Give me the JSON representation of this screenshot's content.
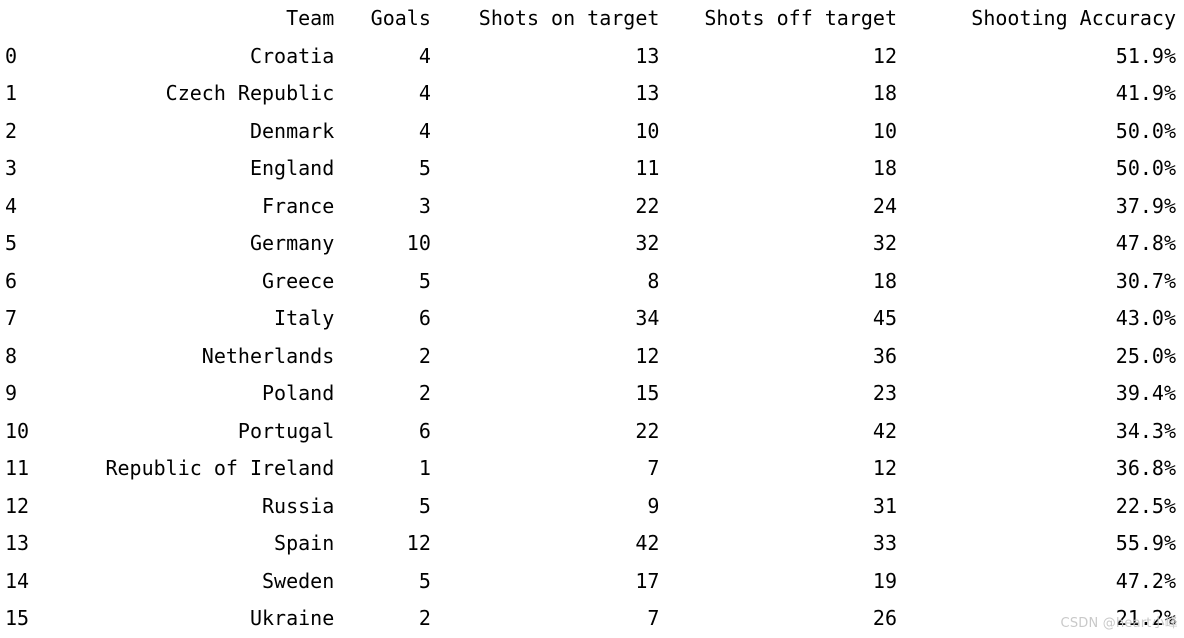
{
  "table": {
    "index_header": "",
    "columns": [
      "Team",
      "Goals",
      "Shots on target",
      "Shots off target",
      "Shooting Accuracy"
    ],
    "rows": [
      {
        "index": "0",
        "team": "Croatia",
        "goals": "4",
        "shots_on": "13",
        "shots_off": "12",
        "accuracy": "51.9%"
      },
      {
        "index": "1",
        "team": "Czech Republic",
        "goals": "4",
        "shots_on": "13",
        "shots_off": "18",
        "accuracy": "41.9%"
      },
      {
        "index": "2",
        "team": "Denmark",
        "goals": "4",
        "shots_on": "10",
        "shots_off": "10",
        "accuracy": "50.0%"
      },
      {
        "index": "3",
        "team": "England",
        "goals": "5",
        "shots_on": "11",
        "shots_off": "18",
        "accuracy": "50.0%"
      },
      {
        "index": "4",
        "team": "France",
        "goals": "3",
        "shots_on": "22",
        "shots_off": "24",
        "accuracy": "37.9%"
      },
      {
        "index": "5",
        "team": "Germany",
        "goals": "10",
        "shots_on": "32",
        "shots_off": "32",
        "accuracy": "47.8%"
      },
      {
        "index": "6",
        "team": "Greece",
        "goals": "5",
        "shots_on": "8",
        "shots_off": "18",
        "accuracy": "30.7%"
      },
      {
        "index": "7",
        "team": "Italy",
        "goals": "6",
        "shots_on": "34",
        "shots_off": "45",
        "accuracy": "43.0%"
      },
      {
        "index": "8",
        "team": "Netherlands",
        "goals": "2",
        "shots_on": "12",
        "shots_off": "36",
        "accuracy": "25.0%"
      },
      {
        "index": "9",
        "team": "Poland",
        "goals": "2",
        "shots_on": "15",
        "shots_off": "23",
        "accuracy": "39.4%"
      },
      {
        "index": "10",
        "team": "Portugal",
        "goals": "6",
        "shots_on": "22",
        "shots_off": "42",
        "accuracy": "34.3%"
      },
      {
        "index": "11",
        "team": "Republic of Ireland",
        "goals": "1",
        "shots_on": "7",
        "shots_off": "12",
        "accuracy": "36.8%"
      },
      {
        "index": "12",
        "team": "Russia",
        "goals": "5",
        "shots_on": "9",
        "shots_off": "31",
        "accuracy": "22.5%"
      },
      {
        "index": "13",
        "team": "Spain",
        "goals": "12",
        "shots_on": "42",
        "shots_off": "33",
        "accuracy": "55.9%"
      },
      {
        "index": "14",
        "team": "Sweden",
        "goals": "5",
        "shots_on": "17",
        "shots_off": "19",
        "accuracy": "47.2%"
      },
      {
        "index": "15",
        "team": "Ukraine",
        "goals": "2",
        "shots_on": "7",
        "shots_off": "26",
        "accuracy": "21.2%"
      }
    ]
  },
  "watermark": {
    "text": "CSDN @heart小峰"
  },
  "colors": {
    "background": "#ffffff",
    "text": "#000000",
    "watermark": "#c9c9c9"
  }
}
